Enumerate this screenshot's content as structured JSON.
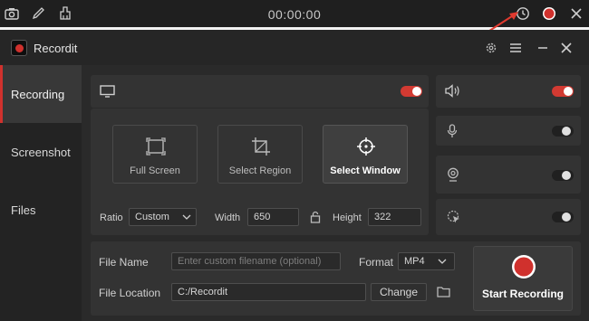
{
  "topbar": {
    "timer": "00:00:00",
    "icons": [
      "camera-icon",
      "pen-icon",
      "eraser-icon",
      "clock-icon",
      "record-icon",
      "close-icon"
    ]
  },
  "app": {
    "title": "Recordit",
    "window_icons": [
      "settings-icon",
      "menu-icon",
      "minimize-icon",
      "close-icon"
    ]
  },
  "sidebar": {
    "items": [
      {
        "label": "Recording",
        "active": true
      },
      {
        "label": "Screenshot",
        "active": false
      },
      {
        "label": "Files",
        "active": false
      }
    ]
  },
  "recording": {
    "screen_toggle": true,
    "modes": [
      {
        "label": "Full Screen",
        "selected": false
      },
      {
        "label": "Select Region",
        "selected": false
      },
      {
        "label": "Select Window",
        "selected": true
      }
    ],
    "ratio_label": "Ratio",
    "ratio_value": "Custom",
    "width_label": "Width",
    "width_value": "650",
    "height_label": "Height",
    "height_value": "322"
  },
  "audio": {
    "system_sound": true,
    "microphone": false,
    "webcam": false,
    "cursor": false
  },
  "output": {
    "file_name_label": "File Name",
    "file_name_placeholder": "Enter custom filename (optional)",
    "format_label": "Format",
    "format_value": "MP4",
    "file_location_label": "File Location",
    "file_location_value": "C:/Recordit",
    "change_label": "Change",
    "start_label": "Start Recording"
  },
  "colors": {
    "accent": "#d0312d",
    "annotation_arrow": "#e03a2f"
  }
}
